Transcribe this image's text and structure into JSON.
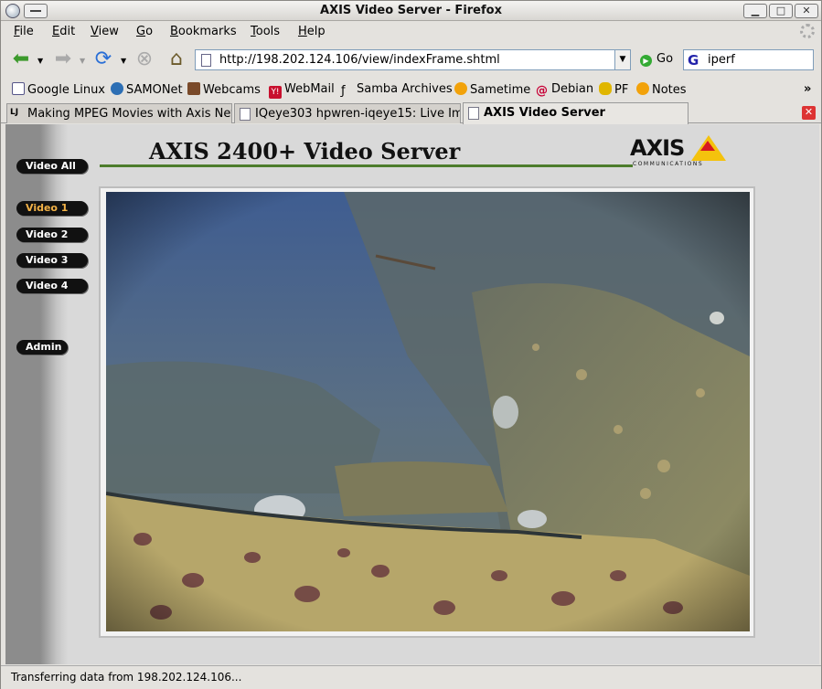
{
  "window": {
    "title": "AXIS Video Server - Firefox"
  },
  "menubar": {
    "items": [
      {
        "prefix": "",
        "underline": "F",
        "rest": "ile"
      },
      {
        "prefix": "",
        "underline": "E",
        "rest": "dit"
      },
      {
        "prefix": "",
        "underline": "V",
        "rest": "iew"
      },
      {
        "prefix": "",
        "underline": "G",
        "rest": "o"
      },
      {
        "prefix": "",
        "underline": "B",
        "rest": "ookmarks"
      },
      {
        "prefix": "",
        "underline": "T",
        "rest": "ools"
      },
      {
        "prefix": "",
        "underline": "H",
        "rest": "elp"
      }
    ]
  },
  "navbar": {
    "url": "http://198.202.124.106/view/indexFrame.shtml",
    "go_label": "Go",
    "search_value": "iperf"
  },
  "bookmarks": [
    {
      "label": "Google Linux"
    },
    {
      "label": "SAMONet"
    },
    {
      "label": "Webcams"
    },
    {
      "label": "WebMail"
    },
    {
      "label": "Samba Archives"
    },
    {
      "label": "Sametime"
    },
    {
      "label": "Debian"
    },
    {
      "label": "PF"
    },
    {
      "label": "Notes"
    }
  ],
  "tabs": [
    {
      "label": "Making MPEG Movies with Axis Net..."
    },
    {
      "label": "IQeye303 hpwren-iqeye15: Live Im..."
    },
    {
      "label": "AXIS Video Server"
    }
  ],
  "page": {
    "title": "AXIS 2400+ Video Server",
    "logo_word": "AXIS",
    "logo_sub": "COMMUNICATIONS",
    "buttons": {
      "video_all": "Video All",
      "video_1": "Video 1",
      "video_2": "Video 2",
      "video_3": "Video 3",
      "video_4": "Video 4",
      "admin": "Admin"
    }
  },
  "status": {
    "text": "Transferring data from 198.202.124.106..."
  },
  "colors": {
    "title_rule": "#4d7d2c",
    "active_video_label": "#f2b247",
    "axis_yellow": "#f4c20d",
    "axis_red": "#d71920"
  }
}
